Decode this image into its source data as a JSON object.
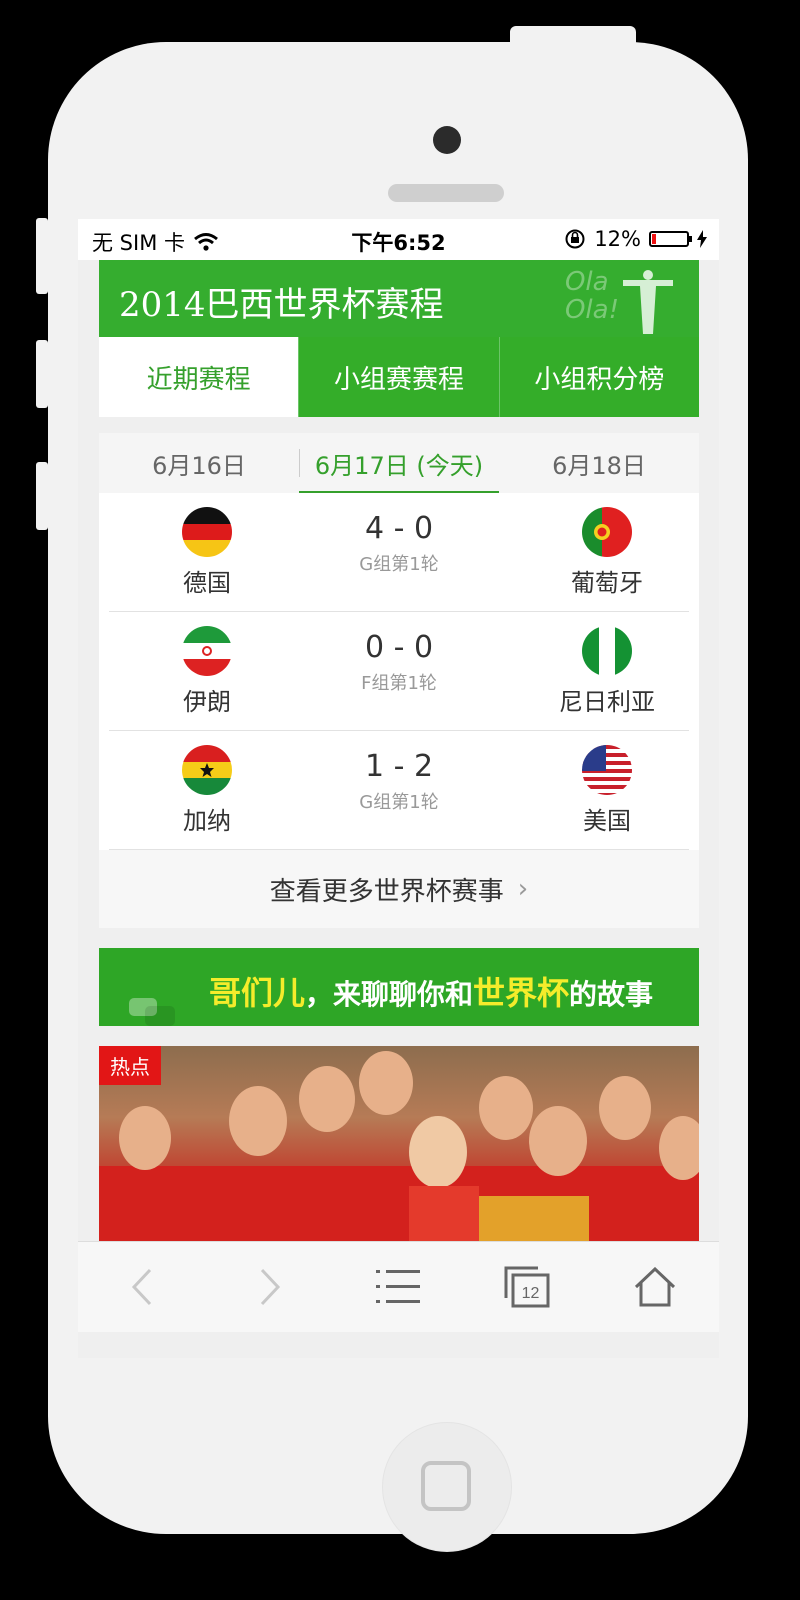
{
  "status_bar": {
    "carrier": "无 SIM 卡",
    "time": "下午6:52",
    "battery": "12%",
    "battery_level": 0.12
  },
  "banner": {
    "title": "2014巴西世界杯赛程",
    "deco": [
      "Ola",
      "Ola!"
    ]
  },
  "tabs": [
    {
      "label": "近期赛程",
      "active": true
    },
    {
      "label": "小组赛赛程",
      "active": false
    },
    {
      "label": "小组积分榜",
      "active": false
    }
  ],
  "dates": [
    {
      "label": "6月16日",
      "active": false
    },
    {
      "label": "6月17日 (今天)",
      "active": true
    },
    {
      "label": "6月18日",
      "active": false
    }
  ],
  "matches": [
    {
      "home": "德国",
      "score": "4 - 0",
      "round": "G组第1轮",
      "away": "葡萄牙"
    },
    {
      "home": "伊朗",
      "score": "0 - 0",
      "round": "F组第1轮",
      "away": "尼日利亚"
    },
    {
      "home": "加纳",
      "score": "1 - 2",
      "round": "G组第1轮",
      "away": "美国"
    }
  ],
  "more_link": "查看更多世界杯赛事",
  "chat_banner": {
    "part1": "哥们儿",
    "part2": "，来聊聊你和",
    "part3": "世界杯",
    "part4": "的故事"
  },
  "hot": {
    "tag": "热点"
  },
  "toolbar": {
    "tabs_count": "12"
  },
  "colors": {
    "accent": "#35ad2f",
    "hot": "#e21616"
  }
}
